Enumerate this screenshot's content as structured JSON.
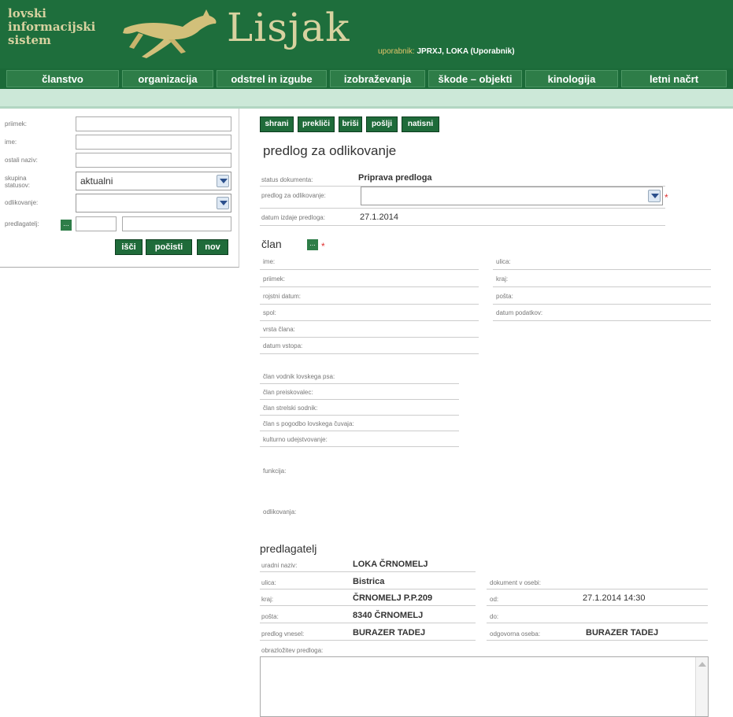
{
  "header": {
    "logo_line1": "lovski",
    "logo_line2": "informacijski",
    "logo_line3": "sistem",
    "brand": "Lisjak",
    "user_label": "uporabnik:",
    "user_value": "JPRXJ, LOKA (Uporabnik)"
  },
  "nav": [
    "članstvo",
    "organizacija",
    "odstrel in izgube",
    "izobraževanja",
    "škode – objekti",
    "kinologija",
    "letni načrt"
  ],
  "search": {
    "priimek_label": "priimek:",
    "ime_label": "ime:",
    "ostali_label": "ostali naziv:",
    "skupina_label1": "skupina",
    "skupina_label2": "statusov:",
    "skupina_value": "aktualni",
    "odlikovanje_label": "odlikovanje:",
    "predlagatelj_label": "predlagatelj:",
    "lookup": "...",
    "btn_isci": "išči",
    "btn_pocisti": "počisti",
    "btn_nov": "nov"
  },
  "toolbar": {
    "shrani": "shrani",
    "preklici": "prekliči",
    "brisi": "briši",
    "poslji": "pošlji",
    "natisni": "natisni"
  },
  "form": {
    "title": "predlog za odlikovanje",
    "status_label": "status dokumenta:",
    "status_value": "Priprava predloga",
    "predlog_label": "predlog za odlikovanje:",
    "datum_izdaje_label": "datum izdaje predloga:",
    "datum_izdaje_value": "27.1.2014",
    "required": "*"
  },
  "clan": {
    "title": "član",
    "lookup": "...",
    "ime": "ime:",
    "priimek": "priimek:",
    "rojstni_datum": "rojstni datum:",
    "spol": "spol:",
    "vrsta_clana": "vrsta člana:",
    "datum_vstopa": "datum vstopa:",
    "ulica": "ulica:",
    "kraj": "kraj:",
    "posta": "pošta:",
    "datum_podatkov": "datum podatkov:",
    "vodnik": "član vodnik lovskega psa:",
    "preiskovalec": "član preiskovalec:",
    "strelski": "član strelski sodnik:",
    "cuvaj": "član s pogodbo lovskega čuvaja:",
    "kulturno": "kulturno udejstvovanje:",
    "funkcija": "funkcija:",
    "odlikovanja": "odlikovanja:"
  },
  "predlagatelj": {
    "title": "predlagatelj",
    "uradni_naziv_label": "uradni naziv:",
    "uradni_naziv_value": "LOKA ČRNOMELJ",
    "ulica_label": "ulica:",
    "ulica_value": "Bistrica",
    "kraj_label": "kraj:",
    "kraj_value": "ČRNOMELJ P.P.209",
    "posta_label": "pošta:",
    "posta_value": "8340 ČRNOMELJ",
    "vnesel_label": "predlog vnesel:",
    "vnesel_value": "BURAZER TADEJ",
    "dok_osebi_label": "dokument v osebi:",
    "od_label": "od:",
    "od_value": "27.1.2014 14:30",
    "do_label": "do:",
    "odgovorna_label": "odgovorna oseba:",
    "odgovorna_value": "BURAZER TADEJ",
    "obrazlozitev_label": "obrazložitev predloga:"
  }
}
